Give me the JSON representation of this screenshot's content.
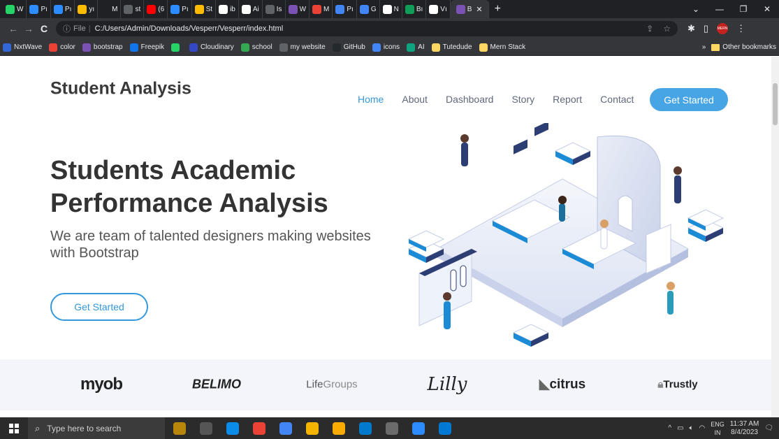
{
  "browser": {
    "tabs": [
      {
        "label": "W",
        "color": "#25d366"
      },
      {
        "label": "Pı",
        "color": "#2d8cff"
      },
      {
        "label": "Pı",
        "color": "#2d8cff"
      },
      {
        "label": "yı",
        "color": "#fbbc04"
      },
      {
        "label": "M",
        "color": "#202124"
      },
      {
        "label": "st",
        "color": "#5f6368"
      },
      {
        "label": "(6",
        "color": "#ff0000"
      },
      {
        "label": "Pı",
        "color": "#2d8cff"
      },
      {
        "label": "St",
        "color": "#fbbc04"
      },
      {
        "label": "ib",
        "color": "#ffffff"
      },
      {
        "label": "Ai",
        "color": "#ffffff"
      },
      {
        "label": "Is",
        "color": "#5f6368"
      },
      {
        "label": "W",
        "color": "#7952b3"
      },
      {
        "label": "M",
        "color": "#ea4335"
      },
      {
        "label": "Pı",
        "color": "#4285f4"
      },
      {
        "label": "G",
        "color": "#4285f4"
      },
      {
        "label": "N",
        "color": "#ffffff"
      },
      {
        "label": "Bı",
        "color": "#0f9d58"
      },
      {
        "label": "Vı",
        "color": "#ffffff"
      }
    ],
    "active_tab": {
      "label": "B",
      "color": "#7952b3"
    },
    "window_controls": [
      "⌄",
      "—",
      "❐",
      "✕"
    ],
    "address": {
      "prefix": "File",
      "url": "C:/Users/Admin/Downloads/Vesperr/Vesperr/index.html"
    },
    "bookmarks": [
      {
        "label": "NxtWave",
        "color": "#3367d6"
      },
      {
        "label": "color",
        "color": "#ea4335"
      },
      {
        "label": "bootstrap",
        "color": "#7952b3"
      },
      {
        "label": "Freepik",
        "color": "#1273eb"
      },
      {
        "label": "",
        "color": "#25d366"
      },
      {
        "label": "Cloudinary",
        "color": "#3448c5"
      },
      {
        "label": "school",
        "color": "#34a853"
      },
      {
        "label": "my website",
        "color": "#5f6368"
      },
      {
        "label": "GitHub",
        "color": "#24292e"
      },
      {
        "label": "icons",
        "color": "#4285f4"
      },
      {
        "label": "AI",
        "color": "#10a37f"
      },
      {
        "label": "Tutedude",
        "color": "#fdd663"
      },
      {
        "label": "Mern Stack",
        "color": "#fdd663"
      }
    ],
    "bookmarks_overflow": "»",
    "other_bookmarks": "Other bookmarks",
    "profile_badge": "MERN"
  },
  "site": {
    "brand": "Student Analysis",
    "nav": [
      "Home",
      "About",
      "Dashboard",
      "Story",
      "Report",
      "Contact"
    ],
    "nav_cta": "Get Started",
    "hero": {
      "title_line1": "Students Academic",
      "title_line2": "Performance Analysis",
      "subtitle": "We are team of talented designers making websites with Bootstrap",
      "cta": "Get Started"
    },
    "clients": {
      "myob": "myob",
      "belimo": "BELIMO",
      "lifegroups_a": "Life",
      "lifegroups_b": "Groups",
      "lilly": "Lilly",
      "citrus": "citrus",
      "trustly": "Trustly"
    },
    "colors": {
      "accent": "#3498db",
      "cta_fill": "#47a5e6",
      "clients_bg": "#f3f5fa"
    }
  },
  "taskbar": {
    "search_placeholder": "Type here to search",
    "apps": [
      {
        "icon": "music-app-icon",
        "color": "#b8860b"
      },
      {
        "icon": "task-view-icon",
        "color": "#555555"
      },
      {
        "icon": "edge-icon",
        "color": "#0c8ce9"
      },
      {
        "icon": "chrome-icon",
        "color": "#ea4335"
      },
      {
        "icon": "chrome-profile-icon",
        "color": "#4285f4"
      },
      {
        "icon": "file-explorer-icon",
        "color": "#f4b400"
      },
      {
        "icon": "chrome-canary-icon",
        "color": "#f9ab00"
      },
      {
        "icon": "vscode-icon",
        "color": "#007acc"
      },
      {
        "icon": "settings-icon",
        "color": "#6b6b6b"
      },
      {
        "icon": "zoom-icon",
        "color": "#2d8cff"
      },
      {
        "icon": "image-viewer-icon",
        "color": "#0078d4"
      }
    ],
    "lang_line1": "ENG",
    "lang_line2": "IN",
    "time": "11:37 AM",
    "date": "8/4/2023"
  }
}
